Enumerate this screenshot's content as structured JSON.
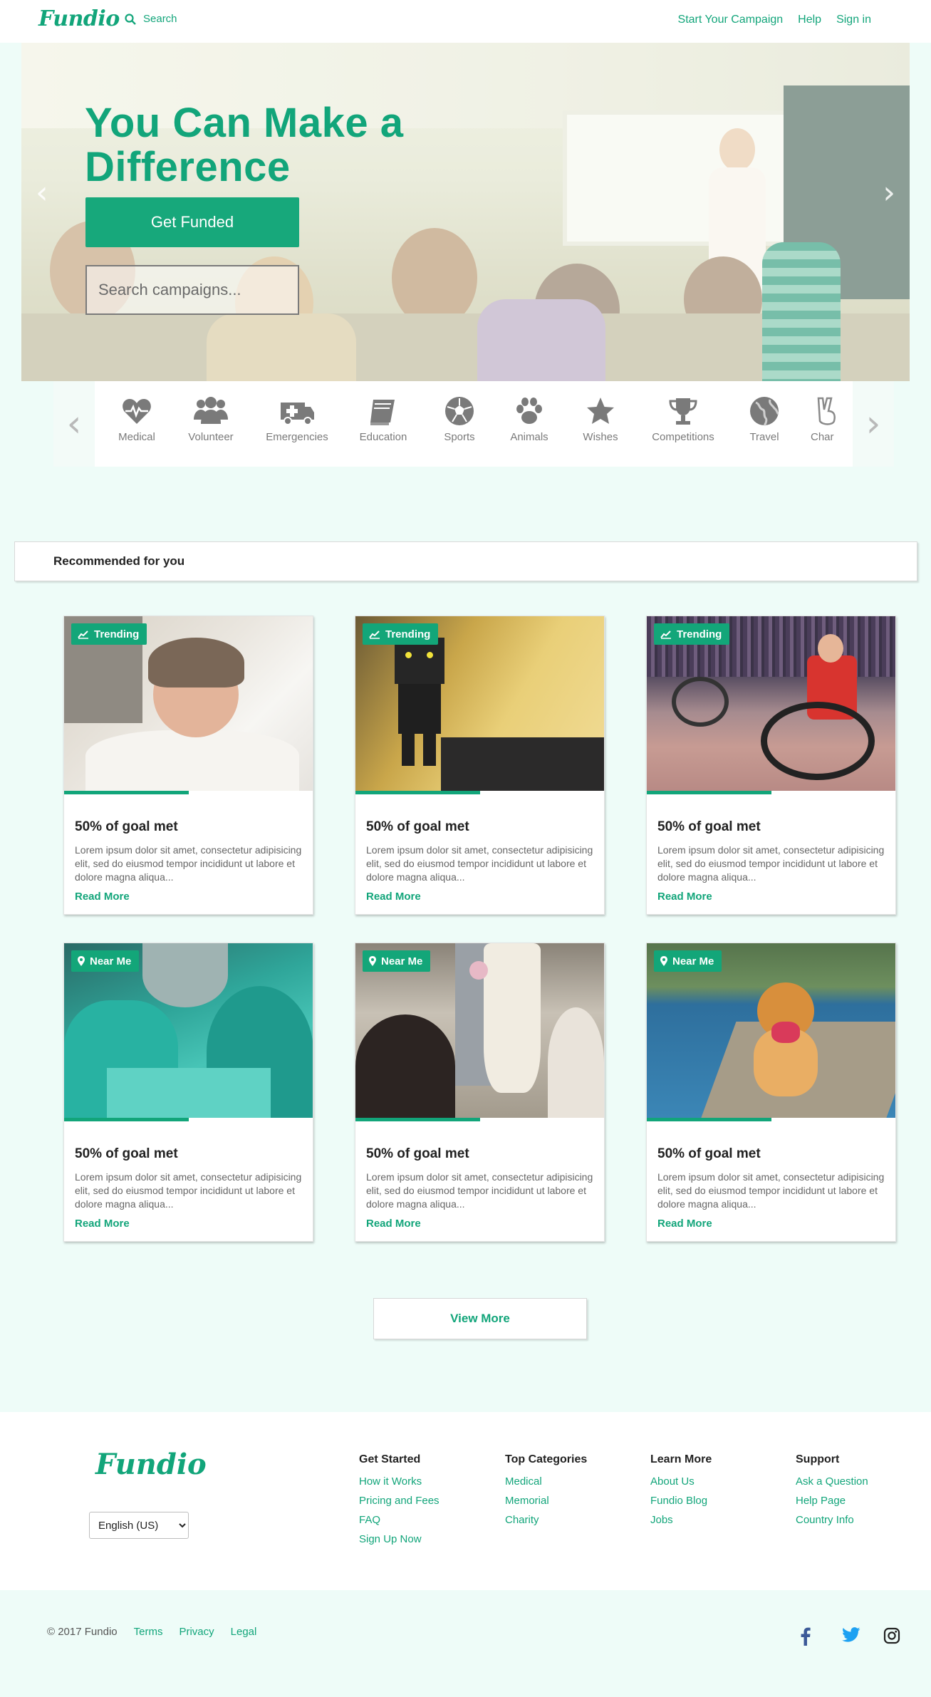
{
  "brand": {
    "name": "Fundio",
    "accent": "#12a57a"
  },
  "nav": {
    "search_label": "Search",
    "start_campaign": "Start Your Campaign",
    "help": "Help",
    "sign_in": "Sign in"
  },
  "hero": {
    "title": "You Can Make a Difference",
    "cta": "Get Funded",
    "search_placeholder": "Search campaigns..."
  },
  "categories": [
    {
      "label": "Medical",
      "icon": "heartbeat-icon"
    },
    {
      "label": "Volunteer",
      "icon": "users-icon"
    },
    {
      "label": "Emergencies",
      "icon": "ambulance-icon"
    },
    {
      "label": "Education",
      "icon": "book-icon"
    },
    {
      "label": "Sports",
      "icon": "soccer-ball-icon"
    },
    {
      "label": "Animals",
      "icon": "paw-icon"
    },
    {
      "label": "Wishes",
      "icon": "star-icon"
    },
    {
      "label": "Competitions",
      "icon": "trophy-icon"
    },
    {
      "label": "Travel",
      "icon": "globe-icon"
    },
    {
      "label": "Char",
      "icon": "peace-hand-icon"
    }
  ],
  "recommended_title": "Recommended for you",
  "cards": [
    {
      "badge": "Trending",
      "badge_icon": "trend-chart-icon",
      "goal": "50% of goal met",
      "progress": 0.5,
      "desc": "Lorem ipsum dolor sit amet, consectetur adipisicing elit, sed do eiusmod tempor incididunt ut labore et dolore magna aliqua...",
      "link": "Read More"
    },
    {
      "badge": "Trending",
      "badge_icon": "trend-chart-icon",
      "goal": "50% of goal met",
      "progress": 0.5,
      "desc": "Lorem ipsum dolor sit amet, consectetur adipisicing elit, sed do eiusmod tempor incididunt ut labore et dolore magna aliqua...",
      "link": "Read More"
    },
    {
      "badge": "Trending",
      "badge_icon": "trend-chart-icon",
      "goal": "50% of goal met",
      "progress": 0.5,
      "desc": "Lorem ipsum dolor sit amet, consectetur adipisicing elit, sed do eiusmod tempor incididunt ut labore et dolore magna aliqua...",
      "link": "Read More"
    },
    {
      "badge": "Near Me",
      "badge_icon": "map-pin-icon",
      "goal": "50% of goal met",
      "progress": 0.5,
      "desc": "Lorem ipsum dolor sit amet, consectetur adipisicing elit, sed do eiusmod tempor incididunt ut labore et dolore magna aliqua...",
      "link": "Read More"
    },
    {
      "badge": "Near Me",
      "badge_icon": "map-pin-icon",
      "goal": "50% of goal met",
      "progress": 0.5,
      "desc": "Lorem ipsum dolor sit amet, consectetur adipisicing elit, sed do eiusmod tempor incididunt ut labore et dolore magna aliqua...",
      "link": "Read More"
    },
    {
      "badge": "Near Me",
      "badge_icon": "map-pin-icon",
      "goal": "50% of goal met",
      "progress": 0.5,
      "desc": "Lorem ipsum dolor sit amet, consectetur adipisicing elit, sed do eiusmod tempor incididunt ut labore et dolore magna aliqua...",
      "link": "Read More"
    }
  ],
  "view_more": "View More",
  "footer": {
    "language": "English (US)",
    "columns": [
      {
        "title": "Get Started",
        "links": [
          "How it Works",
          "Pricing and Fees",
          "FAQ",
          "Sign Up Now"
        ]
      },
      {
        "title": "Top Categories",
        "links": [
          "Medical",
          "Memorial",
          "Charity"
        ]
      },
      {
        "title": "Learn More",
        "links": [
          "About Us",
          "Fundio Blog",
          "Jobs"
        ]
      },
      {
        "title": "Support",
        "links": [
          "Ask a Question",
          "Help Page",
          "Country Info"
        ]
      }
    ],
    "copyright": "© 2017 Fundio",
    "legal_links": [
      "Terms",
      "Privacy",
      "Legal"
    ],
    "social": [
      {
        "icon": "facebook-icon",
        "color": "#3b5998"
      },
      {
        "icon": "twitter-icon",
        "color": "#1da1f2"
      },
      {
        "icon": "instagram-icon",
        "color": "#222222"
      }
    ]
  }
}
